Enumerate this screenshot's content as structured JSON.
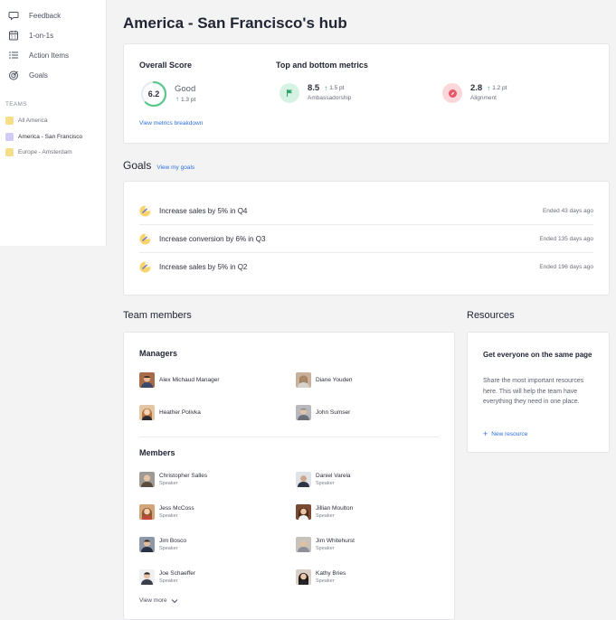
{
  "sidebar": {
    "nav": [
      {
        "label": "Feedback",
        "icon": "feedback-icon"
      },
      {
        "label": "1-on-1s",
        "icon": "calendar-icon"
      },
      {
        "label": "Action Items",
        "icon": "list-icon"
      },
      {
        "label": "Goals",
        "icon": "target-icon"
      }
    ],
    "teams_label": "TEAMS",
    "teams": [
      {
        "label": "All America",
        "color": "#f5dd8a"
      },
      {
        "label": "America - San Francisco",
        "color": "#cfcdf5"
      },
      {
        "label": "Europe - Amsterdam",
        "color": "#f5dd8a"
      }
    ]
  },
  "page": {
    "title": "America - San Francisco's hub"
  },
  "score": {
    "title": "Overall Score",
    "value": "6.2",
    "fraction": 0.62,
    "label": "Good",
    "delta": "1.3 pt",
    "link": "View metrics breakdown"
  },
  "metrics": {
    "title": "Top and bottom metrics",
    "items": [
      {
        "value": "8.5",
        "delta": "1.5 pt",
        "name": "Ambassadorship",
        "icon": "flag-icon"
      },
      {
        "value": "2.8",
        "delta": "1.2 pt",
        "name": "Alignment",
        "icon": "compass-icon"
      }
    ]
  },
  "goals": {
    "title": "Goals",
    "link": "View my goals",
    "items": [
      {
        "name": "Increase sales by 5% in Q4",
        "status": "Ended 43 days ago"
      },
      {
        "name": "Increase conversion by 6% in Q3",
        "status": "Ended 135 days ago"
      },
      {
        "name": "Increase sales by 5% in Q2",
        "status": "Ended 196 days ago"
      }
    ]
  },
  "team": {
    "title": "Team members",
    "managers_title": "Managers",
    "managers": [
      {
        "name": "Alex Michaud Manager"
      },
      {
        "name": "Diane Youden"
      },
      {
        "name": "Heather Polivka"
      },
      {
        "name": "John Sumser"
      }
    ],
    "members_title": "Members",
    "members": [
      {
        "name": "Christopher Salles",
        "role": "Speaker"
      },
      {
        "name": "Daniel Varela",
        "role": "Speaker"
      },
      {
        "name": "Jess McCoss",
        "role": "Speaker"
      },
      {
        "name": "Jillian Moulton",
        "role": "Speaker"
      },
      {
        "name": "Jim Bosco",
        "role": "Speaker"
      },
      {
        "name": "Jim Whitehurst",
        "role": "Speaker"
      },
      {
        "name": "Joe Schaeffer",
        "role": "Speaker"
      },
      {
        "name": "Kathy Bries",
        "role": "Speaker"
      }
    ],
    "view_more": "View more"
  },
  "resources": {
    "title": "Resources",
    "card_title": "Get everyone on the same page",
    "card_text": "Share the most important resources here. This will help the team have everything they need in one place.",
    "new_link": "New resource"
  }
}
